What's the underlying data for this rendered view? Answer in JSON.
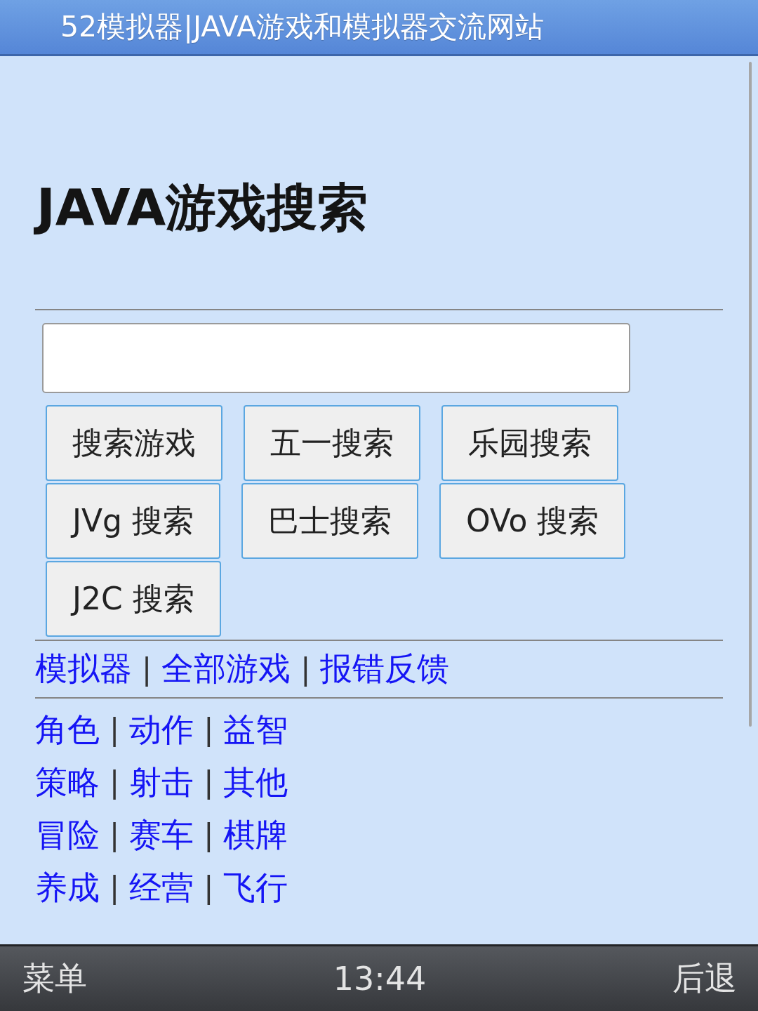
{
  "window": {
    "title": "52模拟器|JAVA游戏和模拟器交流网站"
  },
  "page": {
    "heading": "JAVA游戏搜索"
  },
  "search_buttons": [
    {
      "label": "搜索游戏"
    },
    {
      "label": "五一搜索"
    },
    {
      "label": "乐园搜索"
    },
    {
      "label": "JVg 搜索"
    },
    {
      "label": "巴士搜索"
    },
    {
      "label": "OVo 搜索"
    },
    {
      "label": "J2C 搜索"
    }
  ],
  "nav_links": [
    {
      "kind": "link",
      "label": "模拟器"
    },
    {
      "kind": "separator",
      "label": "|"
    },
    {
      "kind": "link",
      "label": "全部游戏"
    },
    {
      "kind": "separator",
      "label": "|"
    },
    {
      "kind": "link",
      "label": "报错反馈"
    }
  ],
  "category_rows": [
    {
      "items": [
        {
          "kind": "link",
          "label": "角色"
        },
        {
          "kind": "separator",
          "label": "|"
        },
        {
          "kind": "link",
          "label": "动作"
        },
        {
          "kind": "separator",
          "label": "|"
        },
        {
          "kind": "link",
          "label": "益智"
        }
      ]
    },
    {
      "items": [
        {
          "kind": "link",
          "label": "策略"
        },
        {
          "kind": "separator",
          "label": "|"
        },
        {
          "kind": "link",
          "label": "射击"
        },
        {
          "kind": "separator",
          "label": "|"
        },
        {
          "kind": "link",
          "label": "其他"
        }
      ]
    },
    {
      "items": [
        {
          "kind": "link",
          "label": "冒险"
        },
        {
          "kind": "separator",
          "label": "|"
        },
        {
          "kind": "link",
          "label": "赛车"
        },
        {
          "kind": "separator",
          "label": "|"
        },
        {
          "kind": "link",
          "label": "棋牌"
        }
      ]
    },
    {
      "items": [
        {
          "kind": "link",
          "label": "养成"
        },
        {
          "kind": "separator",
          "label": "|"
        },
        {
          "kind": "link",
          "label": "经营"
        },
        {
          "kind": "separator",
          "label": "|"
        },
        {
          "kind": "link",
          "label": "飞行"
        }
      ]
    }
  ],
  "softkeys": {
    "left": "菜单",
    "clock": "13:44",
    "right": "后退"
  }
}
